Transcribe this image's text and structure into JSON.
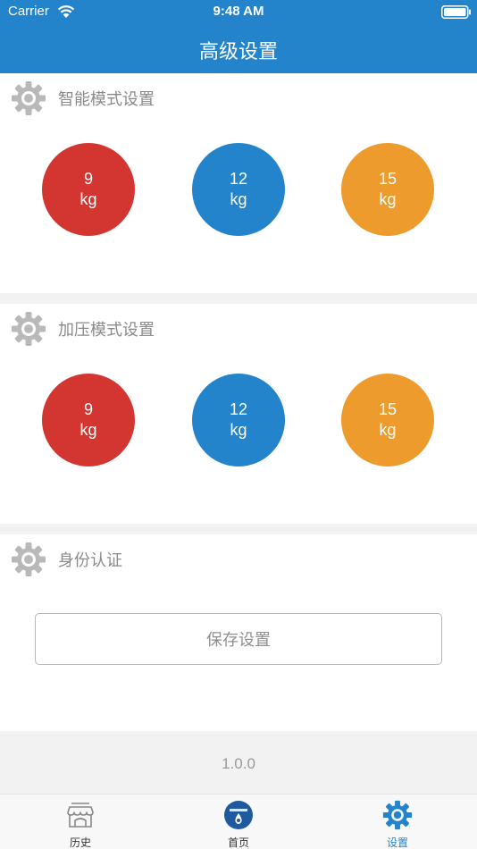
{
  "status_bar": {
    "carrier": "Carrier",
    "time": "9:48 AM"
  },
  "nav": {
    "title": "高级设置"
  },
  "smart_mode": {
    "title": "智能模式设置",
    "options": [
      {
        "value": "9",
        "unit": "kg",
        "color": "#d33631"
      },
      {
        "value": "12",
        "unit": "kg",
        "color": "#2384cc"
      },
      {
        "value": "15",
        "unit": "kg",
        "color": "#ec9b2c"
      }
    ]
  },
  "pressure_mode": {
    "title": "加压模式设置",
    "options": [
      {
        "value": "9",
        "unit": "kg",
        "color": "#d33631"
      },
      {
        "value": "12",
        "unit": "kg",
        "color": "#2384cc"
      },
      {
        "value": "15",
        "unit": "kg",
        "color": "#ec9b2c"
      }
    ]
  },
  "identity": {
    "title": "身份认证",
    "save_label": "保存设置"
  },
  "version": "1.0.0",
  "tabbar": {
    "items": [
      {
        "label": "历史",
        "icon": "store-icon"
      },
      {
        "label": "首页",
        "icon": "home-logo-icon"
      },
      {
        "label": "设置",
        "icon": "gear-icon"
      }
    ],
    "active_index": 2
  },
  "colors": {
    "primary": "#2384cc",
    "red": "#d33631",
    "orange": "#ec9b2c"
  }
}
